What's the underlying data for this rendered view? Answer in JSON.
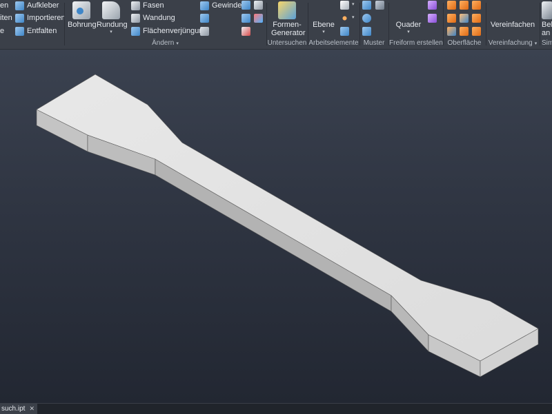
{
  "ribbon": {
    "col1_labels": [
      "en",
      "iten",
      "e"
    ],
    "col2_labels": [
      "Aufkleber",
      "Importieren",
      "Entfalten"
    ],
    "bohrung": "Bohrung",
    "rundung": "Rundung",
    "fasen": "Fasen",
    "wandung": "Wandung",
    "flaechenverjuengung": "Flächenverjüngung",
    "gewinde": "Gewinde",
    "formen_generator_line1": "Formen-",
    "formen_generator_line2": "Generator",
    "ebene": "Ebene",
    "quader": "Quader",
    "vereinfachen": "Vereinfachen",
    "bela_line1": "Bela",
    "bela_line2": "an",
    "groups": {
      "aendern": "Ändern",
      "untersuchen": "Untersuchen",
      "arbeitselemente": "Arbeitselemente",
      "muster": "Muster",
      "freiform": "Freiform erstellen",
      "oberflaeche": "Oberfläche",
      "vereinfachung": "Vereinfachung",
      "sim": "Sim"
    },
    "colors": {
      "ribbon_bg": "#3b4049",
      "accent_orange": "#e06a14",
      "accent_blue": "#3f86c8",
      "accent_purple": "#8a4fd8"
    }
  },
  "document_tab": {
    "name": "such.ipt",
    "close": "✕"
  },
  "viewport": {
    "part_color": "#e3e3e3",
    "background_top": "#3b4250",
    "background_bottom": "#222732"
  }
}
